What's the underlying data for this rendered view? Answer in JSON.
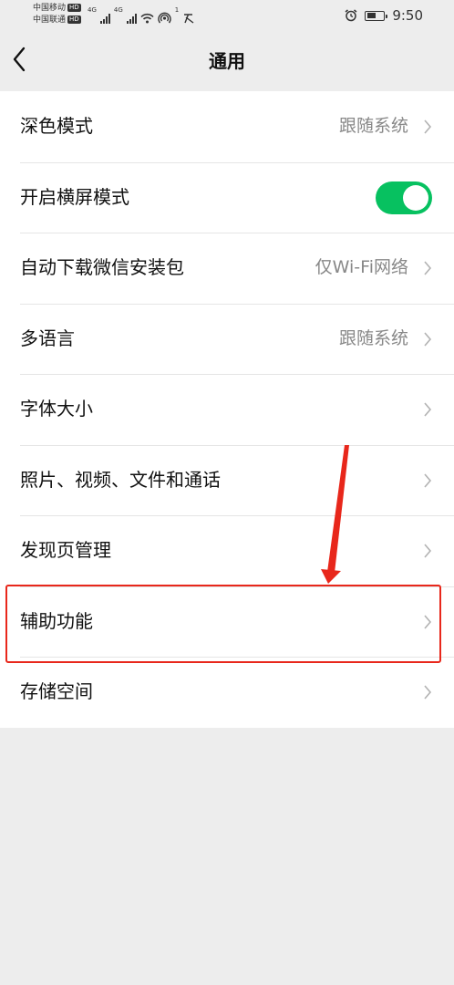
{
  "status_bar": {
    "carrier_1": "中国移动",
    "carrier_2": "中国联通",
    "hd_badge": "HD",
    "network_1": "4G",
    "network_2": "4G",
    "hotspot_count": "1",
    "time": "9:50",
    "battery_level": 0.6,
    "icons": [
      "signal-icon",
      "wifi-icon",
      "hotspot-icon",
      "app-icon",
      "alarm-icon",
      "battery-icon"
    ]
  },
  "nav": {
    "title": "通用",
    "back_icon": "chevron-left-icon"
  },
  "settings": {
    "dark_mode": {
      "label": "深色模式",
      "value": "跟随系统"
    },
    "landscape": {
      "label": "开启横屏模式",
      "enabled": true
    },
    "auto_download": {
      "label": "自动下载微信安装包",
      "value": "仅Wi-Fi网络"
    },
    "language": {
      "label": "多语言",
      "value": "跟随系统"
    },
    "font_size": {
      "label": "字体大小"
    },
    "media": {
      "label": "照片、视频、文件和通话"
    },
    "discover": {
      "label": "发现页管理"
    },
    "accessibility": {
      "label": "辅助功能",
      "highlighted": true
    },
    "storage": {
      "label": "存储空间"
    }
  },
  "colors": {
    "accent": "#07c160",
    "annotation": "#e8271b",
    "background": "#ededed"
  }
}
